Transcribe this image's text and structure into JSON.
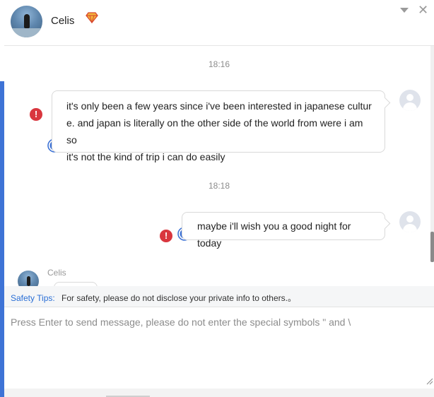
{
  "header": {
    "contact_name": "Celis",
    "icons": [
      "vip-diamond-icon",
      "chevron-down-icon",
      "close-icon"
    ]
  },
  "messages": [
    {
      "time": "18:16",
      "text_lines": [
        "it's only been a few years since i've been interested in japanese cultur",
        "e. and japan is literally on the other side of the world from were i am so",
        "it's not the kind of trip i can do easily"
      ],
      "status": "error",
      "translate_icon": "globe-icon"
    },
    {
      "time": "18:18",
      "text_lines": [
        "maybe i'll wish you a good night for today"
      ],
      "status": "error",
      "translate_icon": "globe-icon"
    }
  ],
  "incoming": {
    "sender": "Celis"
  },
  "tips": {
    "label": "Safety Tips:",
    "text": "For safety, please do not disclose your private info to others.。"
  },
  "input": {
    "placeholder": "Press Enter to send message, please do not enter the special symbols \" and \\",
    "value": ""
  },
  "colors": {
    "accent": "#3e73d6",
    "error": "#d9363e",
    "tips_label": "#2a6fd6"
  }
}
